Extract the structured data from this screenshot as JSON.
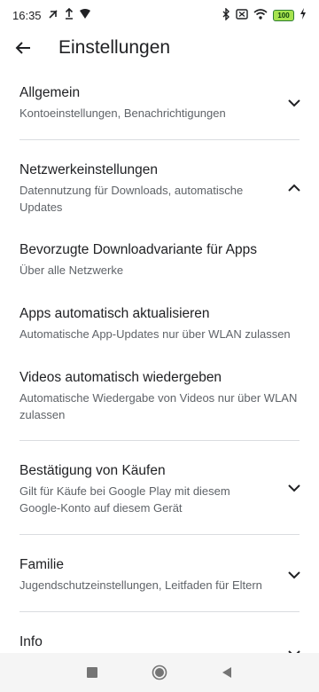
{
  "status": {
    "time": "16:35",
    "battery": "100",
    "icons_left": [
      "nfc-off-icon",
      "upload-icon",
      "signal-icon"
    ],
    "icons_right": [
      "bluetooth-icon",
      "sim-off-icon",
      "wifi-icon",
      "battery-icon",
      "charging-icon"
    ]
  },
  "header": {
    "title": "Einstellungen"
  },
  "sections": {
    "allgemein": {
      "title": "Allgemein",
      "subtitle": "Kontoeinstellungen, Benachrichtigungen",
      "expanded": false
    },
    "netzwerk": {
      "title": "Netzwerkeinstellungen",
      "subtitle": "Datennutzung für Downloads, automatische Updates",
      "expanded": true,
      "items": [
        {
          "title": "Bevorzugte Downloadvariante für Apps",
          "subtitle": "Über alle Netzwerke"
        },
        {
          "title": "Apps automatisch aktualisieren",
          "subtitle": "Automatische App-Updates nur über WLAN zulassen"
        },
        {
          "title": "Videos automatisch wiedergeben",
          "subtitle": "Automatische Wiedergabe von Videos nur über WLAN zulassen"
        }
      ]
    },
    "kaeufe": {
      "title": "Bestätigung von Käufen",
      "subtitle": "Gilt für Käufe bei Google Play mit diesem Google-Konto auf diesem Gerät",
      "expanded": false
    },
    "familie": {
      "title": "Familie",
      "subtitle": "Jugendschutzeinstellungen, Leitfaden für Eltern",
      "expanded": false
    },
    "info": {
      "title": "Info",
      "expanded": false
    }
  },
  "navbar": {
    "buttons": [
      "recents-button",
      "home-button",
      "back-button"
    ]
  }
}
